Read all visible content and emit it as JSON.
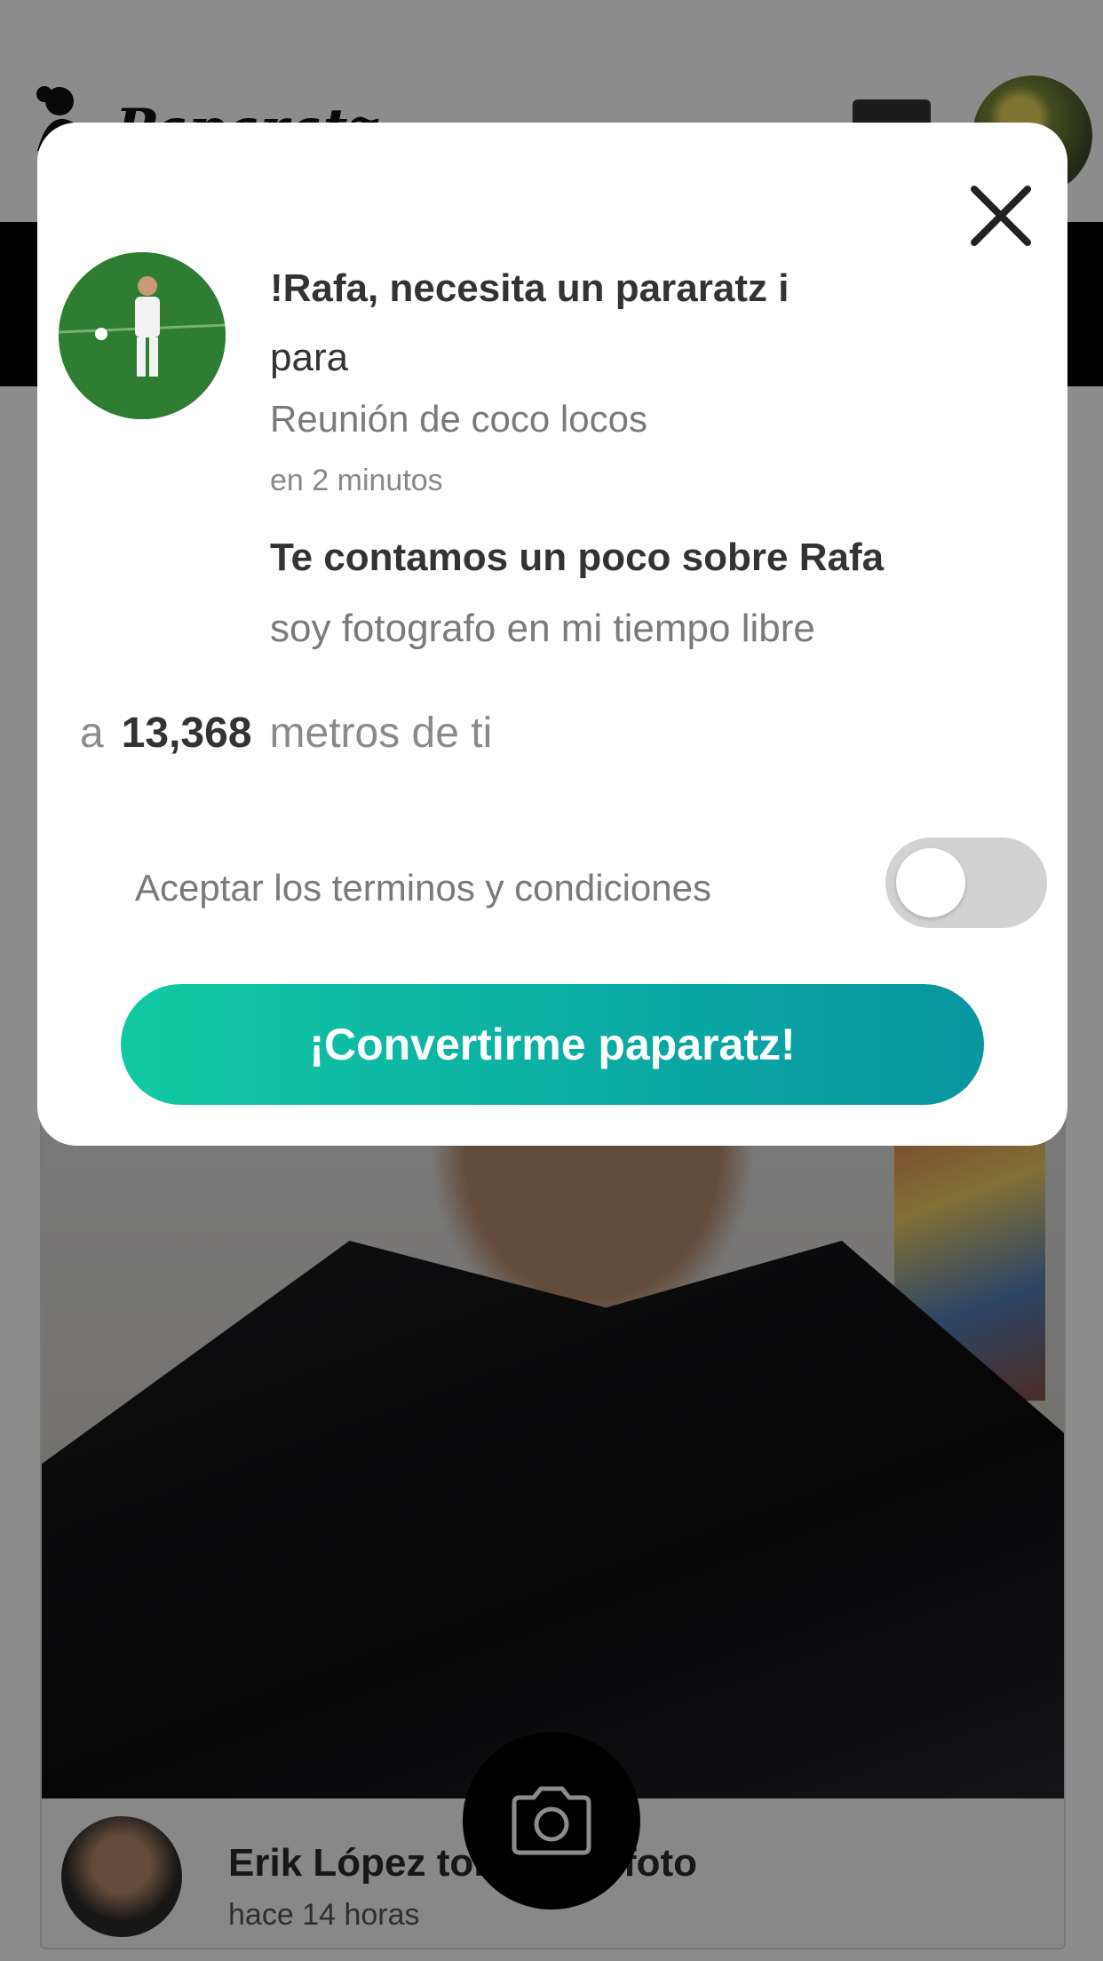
{
  "app": {
    "logo_text": "Paparatz",
    "post": {
      "author_line": "Erik López tomó una foto",
      "time": "hace 14 horas"
    }
  },
  "modal": {
    "title": "!Rafa, necesita un pararatz i",
    "title_suffix": "para",
    "event": "Reunión de coco locos",
    "when": "en 2 minutos",
    "about_heading": "Te contamos un poco sobre Rafa",
    "about_text": "soy fotografo en mi tiempo libre",
    "distance_prefix": "a",
    "distance_value": "13,368",
    "distance_suffix": "metros de ti",
    "terms_label": "Aceptar los terminos y condiciones",
    "terms_accepted": false,
    "cta_label": "¡Convertirme paparatz!"
  },
  "colors": {
    "accent_start": "#12c9a3",
    "accent_end": "#0995a0",
    "overlay": "rgba(0,0,0,0.45)"
  },
  "icons": [
    "logo-icon",
    "close-icon",
    "camera-icon"
  ]
}
